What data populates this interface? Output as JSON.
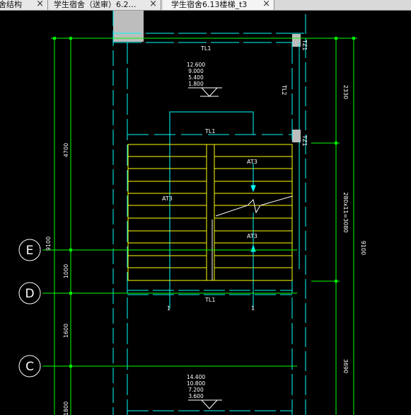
{
  "tabs": [
    {
      "label": "舍结构",
      "close": "×"
    },
    {
      "label": "学生宿舍（送审）6.2…",
      "close": "×"
    },
    {
      "label": "学生宿舍6.13楼梯_t3",
      "close": "×"
    }
  ],
  "colors": {
    "background": "#000000",
    "axis_green": "#00ff00",
    "wall_cyan": "#00ffff",
    "stair_yellow": "#ffff00",
    "text_white": "#ffffff",
    "column_gray": "#bdbdbd"
  },
  "drawing": {
    "labels": {
      "tl1_top": "TL1",
      "tl1_mid": "TL1",
      "tl1_bottom": "TL1",
      "tl2": "TL2",
      "tz1_top": "TZ1",
      "tz1_mid": "TZ1",
      "at3_upper": "AT3",
      "at3_lower": "AT3",
      "at3_left": "AT3",
      "section_mark_left": "1",
      "section_mark_right": "1"
    },
    "elevations_upper": [
      "12.600",
      "9.000",
      "5.400",
      "1.800"
    ],
    "elevations_lower": [
      "14.400",
      "10.800",
      "7.200",
      "3.600"
    ],
    "dimensions": {
      "left_4700": "4700",
      "left_9100": "9100",
      "left_1000": "1000",
      "left_1600": "1600",
      "left_1800": "1800",
      "right_2330": "2330",
      "right_stairs": "280x11=3080",
      "right_3690": "3690",
      "right_9100": "9100"
    },
    "axes": [
      "E",
      "D",
      "C"
    ]
  }
}
